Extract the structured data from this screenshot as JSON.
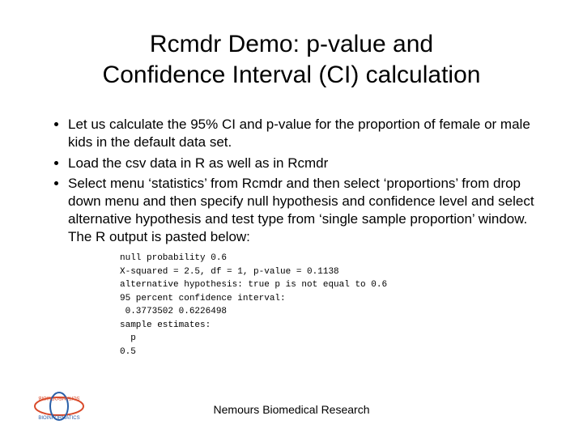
{
  "title_line1": "Rcmdr Demo: p-value and",
  "title_line2": "Confidence Interval (CI) calculation",
  "bullets": [
    "Let us calculate the 95% CI and p-value for the proportion of female or male kids in the default data set.",
    "Load the csv data in R as well as in Rcmdr",
    "Select menu ‘statistics’ from Rcmdr and then select ‘proportions’ from drop down menu and then specify null hypothesis and confidence level and select alternative hypothesis and test type from ‘single sample proportion’ window. The R output is pasted below:"
  ],
  "code_lines": [
    "null probability 0.6",
    "X-squared = 2.5, df = 1, p-value = 0.1138",
    "alternative hypothesis: true p is not equal to 0.6",
    "95 percent confidence interval:",
    " 0.3773502 0.6226498",
    "sample estimates:",
    "  p",
    "0.5"
  ],
  "footer": "Nemours Biomedical Research",
  "logo_top": "BIOINFORMATICS",
  "logo_bottom": "BIOINFORMATICS"
}
